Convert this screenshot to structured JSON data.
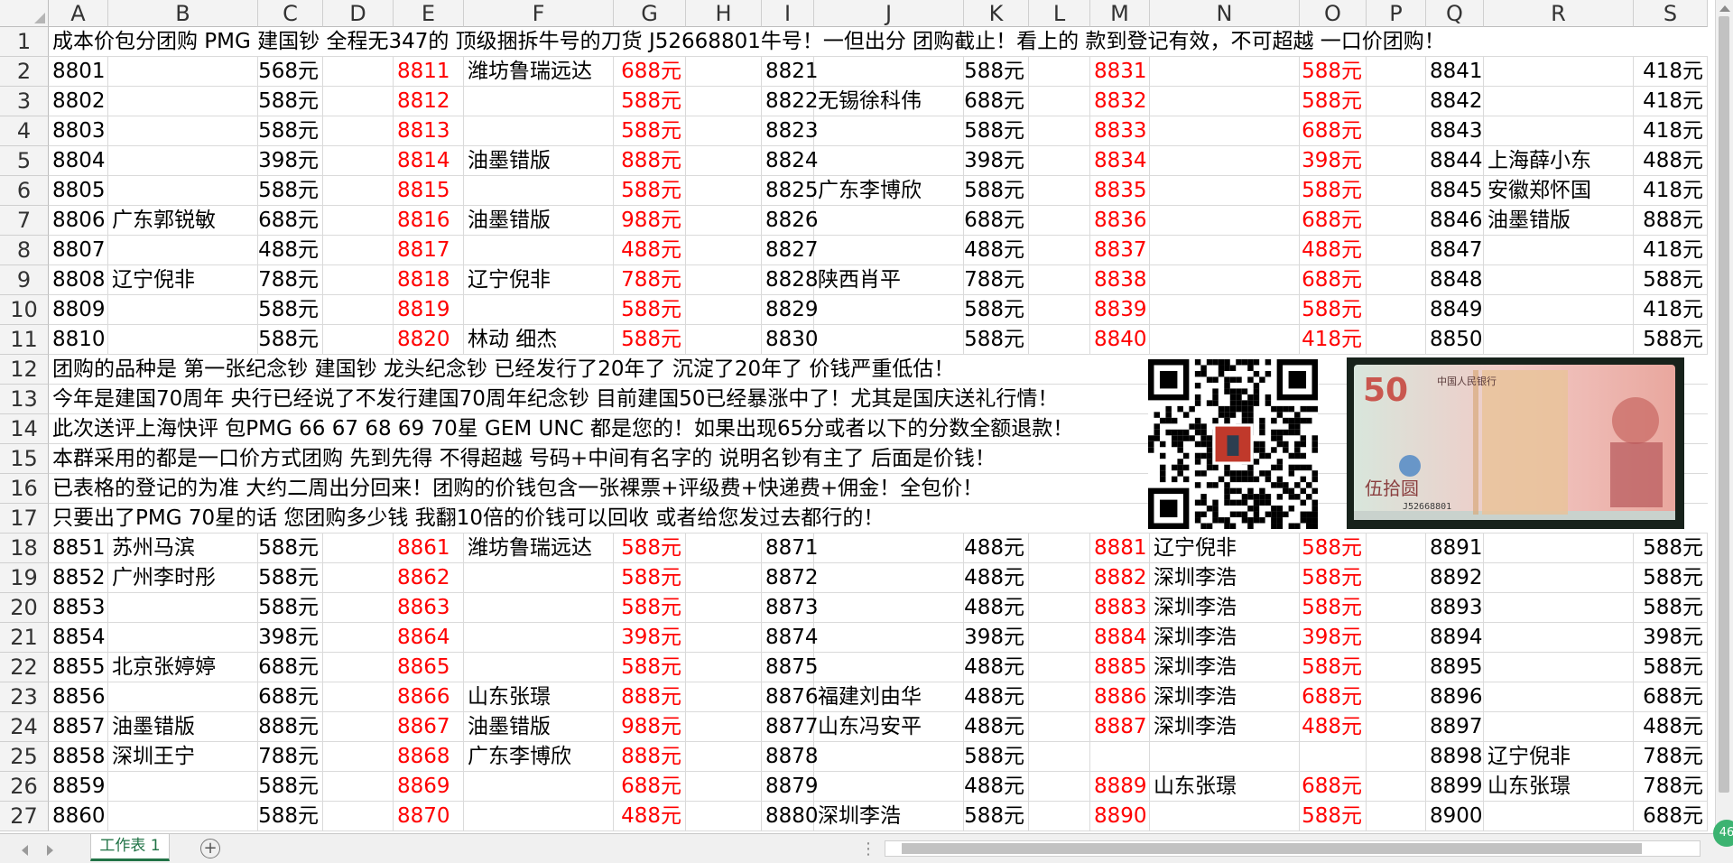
{
  "columns": [
    "A",
    "B",
    "C",
    "D",
    "E",
    "F",
    "G",
    "H",
    "I",
    "J",
    "K",
    "L",
    "M",
    "N",
    "O",
    "P",
    "Q",
    "R",
    "S"
  ],
  "rows": [
    {
      "n": 1,
      "notice": "成本价包分团购 PMG 建国钞 全程无347的 顶级捆拆牛号的刀货 J52668801牛号！一但出分 团购截止！看上的 款到登记有效，不可超越 一口价团购！"
    },
    {
      "n": 2,
      "cells": {
        "A": "8801",
        "C": "568元",
        "E": "8811",
        "F": "潍坊鲁瑞远达",
        "G": "688元",
        "I": "8821",
        "K": "588元",
        "M": "8831",
        "O": "588元",
        "Q": "8841",
        "S": "418元"
      }
    },
    {
      "n": 3,
      "cells": {
        "A": "8802",
        "C": "588元",
        "E": "8812",
        "G": "588元",
        "I": "8822",
        "J": "无锡徐科伟",
        "K": "688元",
        "M": "8832",
        "O": "588元",
        "Q": "8842",
        "S": "418元"
      }
    },
    {
      "n": 4,
      "cells": {
        "A": "8803",
        "C": "588元",
        "E": "8813",
        "G": "588元",
        "I": "8823",
        "K": "588元",
        "M": "8833",
        "O": "688元",
        "Q": "8843",
        "S": "418元"
      }
    },
    {
      "n": 5,
      "cells": {
        "A": "8804",
        "C": "398元",
        "E": "8814",
        "F": "油墨错版",
        "G": "888元",
        "I": "8824",
        "K": "398元",
        "M": "8834",
        "O": "398元",
        "Q": "8844",
        "R": "上海薛小东",
        "S": "488元"
      }
    },
    {
      "n": 6,
      "cells": {
        "A": "8805",
        "C": "588元",
        "E": "8815",
        "G": "588元",
        "I": "8825",
        "J": "广东李博欣",
        "K": "588元",
        "M": "8835",
        "O": "588元",
        "Q": "8845",
        "R": "安徽郑怀国",
        "S": "418元"
      }
    },
    {
      "n": 7,
      "cells": {
        "A": "8806",
        "B": "广东郭锐敏",
        "C": "688元",
        "E": "8816",
        "F": "油墨错版",
        "G": "988元",
        "I": "8826",
        "K": "688元",
        "M": "8836",
        "O": "688元",
        "Q": "8846",
        "R": "油墨错版",
        "S": "888元"
      }
    },
    {
      "n": 8,
      "cells": {
        "A": "8807",
        "C": "488元",
        "E": "8817",
        "G": "488元",
        "I": "8827",
        "K": "488元",
        "M": "8837",
        "O": "488元",
        "Q": "8847",
        "S": "418元"
      }
    },
    {
      "n": 9,
      "cells": {
        "A": "8808",
        "B": "辽宁倪非",
        "C": "788元",
        "E": "8818",
        "F": "辽宁倪非",
        "G": "788元",
        "I": "8828",
        "J": "陕西肖平",
        "K": "788元",
        "M": "8838",
        "O": "688元",
        "Q": "8848",
        "S": "588元"
      }
    },
    {
      "n": 10,
      "cells": {
        "A": "8809",
        "C": "588元",
        "E": "8819",
        "G": "588元",
        "I": "8829",
        "K": "588元",
        "M": "8839",
        "O": "588元",
        "Q": "8849",
        "S": "418元"
      }
    },
    {
      "n": 11,
      "cells": {
        "A": "8810",
        "C": "588元",
        "E": "8820",
        "F": "林动 细杰",
        "G": "588元",
        "I": "8830",
        "K": "588元",
        "M": "8840",
        "O": "418元",
        "Q": "8850",
        "S": "588元"
      }
    },
    {
      "n": 12,
      "notice": "团购的品种是 第一张纪念钞 建国钞 龙头纪念钞 已经发行了20年了 沉淀了20年了 价钱严重低估！"
    },
    {
      "n": 13,
      "notice": "今年是建国70周年 央行已经说了不发行建国70周年纪念钞 目前建国50已经暴涨中了！尤其是国庆送礼行情！"
    },
    {
      "n": 14,
      "notice": "此次送评上海快评 包PMG 66 67 68 69 70星 GEM UNC 都是您的！如果出现65分或者以下的分数全额退款！"
    },
    {
      "n": 15,
      "notice": "本群采用的都是一口价方式团购 先到先得 不得超越 号码+中间有名字的 说明名钞有主了 后面是价钱！"
    },
    {
      "n": 16,
      "notice": "已表格的登记的为准 大约二周出分回来！团购的价钱包含一张裸票+评级费+快递费+佣金！全包价！"
    },
    {
      "n": 17,
      "notice": "只要出了PMG 70星的话 您团购多少钱 我翻10倍的价钱可以回收 或者给您发过去都行的！"
    },
    {
      "n": 18,
      "cells": {
        "A": "8851",
        "B": "苏州马滨",
        "C": "588元",
        "E": "8861",
        "F": "潍坊鲁瑞远达",
        "G": "588元",
        "I": "8871",
        "K": "488元",
        "M": "8881",
        "N": "辽宁倪非",
        "O": "588元",
        "Q": "8891",
        "S": "588元"
      }
    },
    {
      "n": 19,
      "cells": {
        "A": "8852",
        "B": "广州李时彤",
        "C": "588元",
        "E": "8862",
        "G": "588元",
        "I": "8872",
        "K": "488元",
        "M": "8882",
        "N": "深圳李浩",
        "O": "588元",
        "Q": "8892",
        "S": "588元"
      }
    },
    {
      "n": 20,
      "cells": {
        "A": "8853",
        "C": "588元",
        "E": "8863",
        "G": "588元",
        "I": "8873",
        "K": "488元",
        "M": "8883",
        "N": "深圳李浩",
        "O": "588元",
        "Q": "8893",
        "S": "588元"
      }
    },
    {
      "n": 21,
      "cells": {
        "A": "8854",
        "C": "398元",
        "E": "8864",
        "G": "398元",
        "I": "8874",
        "K": "398元",
        "M": "8884",
        "N": "深圳李浩",
        "O": "398元",
        "Q": "8894",
        "S": "398元"
      }
    },
    {
      "n": 22,
      "cells": {
        "A": "8855",
        "B": "北京张婷婷",
        "C": "688元",
        "E": "8865",
        "G": "588元",
        "I": "8875",
        "K": "488元",
        "M": "8885",
        "N": "深圳李浩",
        "O": "588元",
        "Q": "8895",
        "S": "588元"
      }
    },
    {
      "n": 23,
      "cells": {
        "A": "8856",
        "C": "688元",
        "E": "8866",
        "F": "山东张璟",
        "G": "888元",
        "I": "8876",
        "J": "福建刘由华",
        "K": "488元",
        "M": "8886",
        "N": "深圳李浩",
        "O": "688元",
        "Q": "8896",
        "S": "688元"
      }
    },
    {
      "n": 24,
      "cells": {
        "A": "8857",
        "B": "油墨错版",
        "C": "888元",
        "E": "8867",
        "F": "油墨错版",
        "G": "988元",
        "I": "8877",
        "J": "山东冯安平",
        "K": "488元",
        "M": "8887",
        "N": "深圳李浩",
        "O": "488元",
        "Q": "8897",
        "S": "488元"
      }
    },
    {
      "n": 25,
      "cells": {
        "A": "8858",
        "B": "深圳王宁",
        "C": "788元",
        "E": "8868",
        "F": "广东李博欣",
        "G": "888元",
        "I": "8878",
        "K": "588元",
        "Q": "8898",
        "R": "辽宁倪非",
        "S": "788元"
      }
    },
    {
      "n": 26,
      "cells": {
        "A": "8859",
        "C": "588元",
        "E": "8869",
        "G": "688元",
        "I": "8879",
        "K": "488元",
        "M": "8889",
        "N": "山东张璟",
        "O": "688元",
        "Q": "8899",
        "R": "山东张璟",
        "S": "788元"
      }
    },
    {
      "n": 27,
      "cells": {
        "A": "8860",
        "C": "588元",
        "E": "8870",
        "G": "488元",
        "I": "8880",
        "J": "深圳李浩",
        "K": "588元",
        "M": "8890",
        "O": "588元",
        "Q": "8900",
        "S": "688元"
      }
    }
  ],
  "red_columns": [
    "E",
    "G",
    "M",
    "O"
  ],
  "sheet_tab": {
    "label": "工作表 1"
  },
  "add_sheet": {
    "label": "+"
  },
  "banknote": {
    "value": "50",
    "header": "中国人民银行",
    "denomination": "伍拾圆",
    "serial": "J52668801"
  },
  "zoom_badge": {
    "label": "46"
  },
  "colors": {
    "red": "#ff0000",
    "accent": "#217346",
    "header_bg": "#f3f3f3",
    "grid": "#dadada"
  }
}
